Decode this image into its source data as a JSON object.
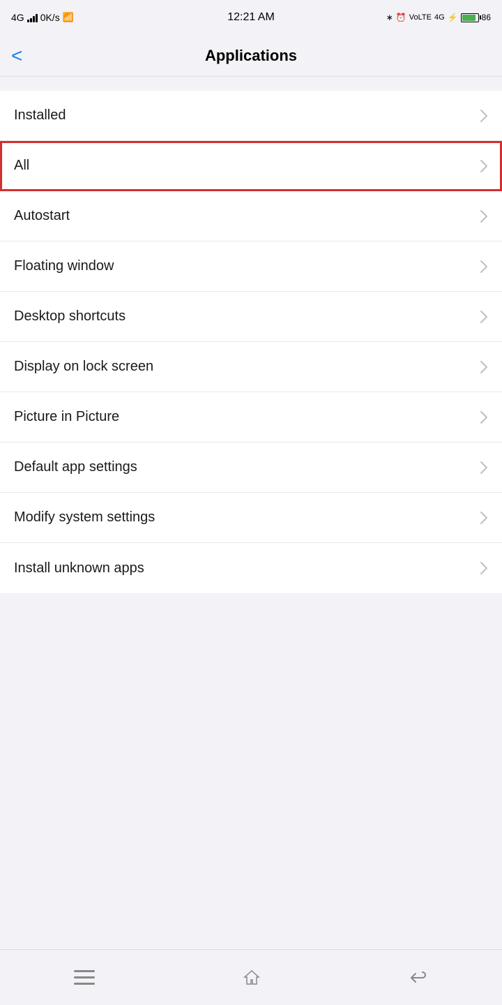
{
  "statusBar": {
    "left": "4G  0K/s",
    "time": "12:21 AM",
    "battery": "86"
  },
  "header": {
    "backLabel": "<",
    "title": "Applications"
  },
  "menuItems": [
    {
      "id": "installed",
      "label": "Installed",
      "highlighted": false
    },
    {
      "id": "all",
      "label": "All",
      "highlighted": true
    },
    {
      "id": "autostart",
      "label": "Autostart",
      "highlighted": false
    },
    {
      "id": "floating-window",
      "label": "Floating window",
      "highlighted": false
    },
    {
      "id": "desktop-shortcuts",
      "label": "Desktop shortcuts",
      "highlighted": false
    },
    {
      "id": "display-lock-screen",
      "label": "Display on lock screen",
      "highlighted": false
    },
    {
      "id": "picture-in-picture",
      "label": "Picture in Picture",
      "highlighted": false
    },
    {
      "id": "default-app-settings",
      "label": "Default app settings",
      "highlighted": false
    },
    {
      "id": "modify-system-settings",
      "label": "Modify system settings",
      "highlighted": false
    },
    {
      "id": "install-unknown-apps",
      "label": "Install unknown apps",
      "highlighted": false
    }
  ],
  "bottomNav": {
    "menu": "☰",
    "home": "⌂",
    "back": "↩"
  }
}
